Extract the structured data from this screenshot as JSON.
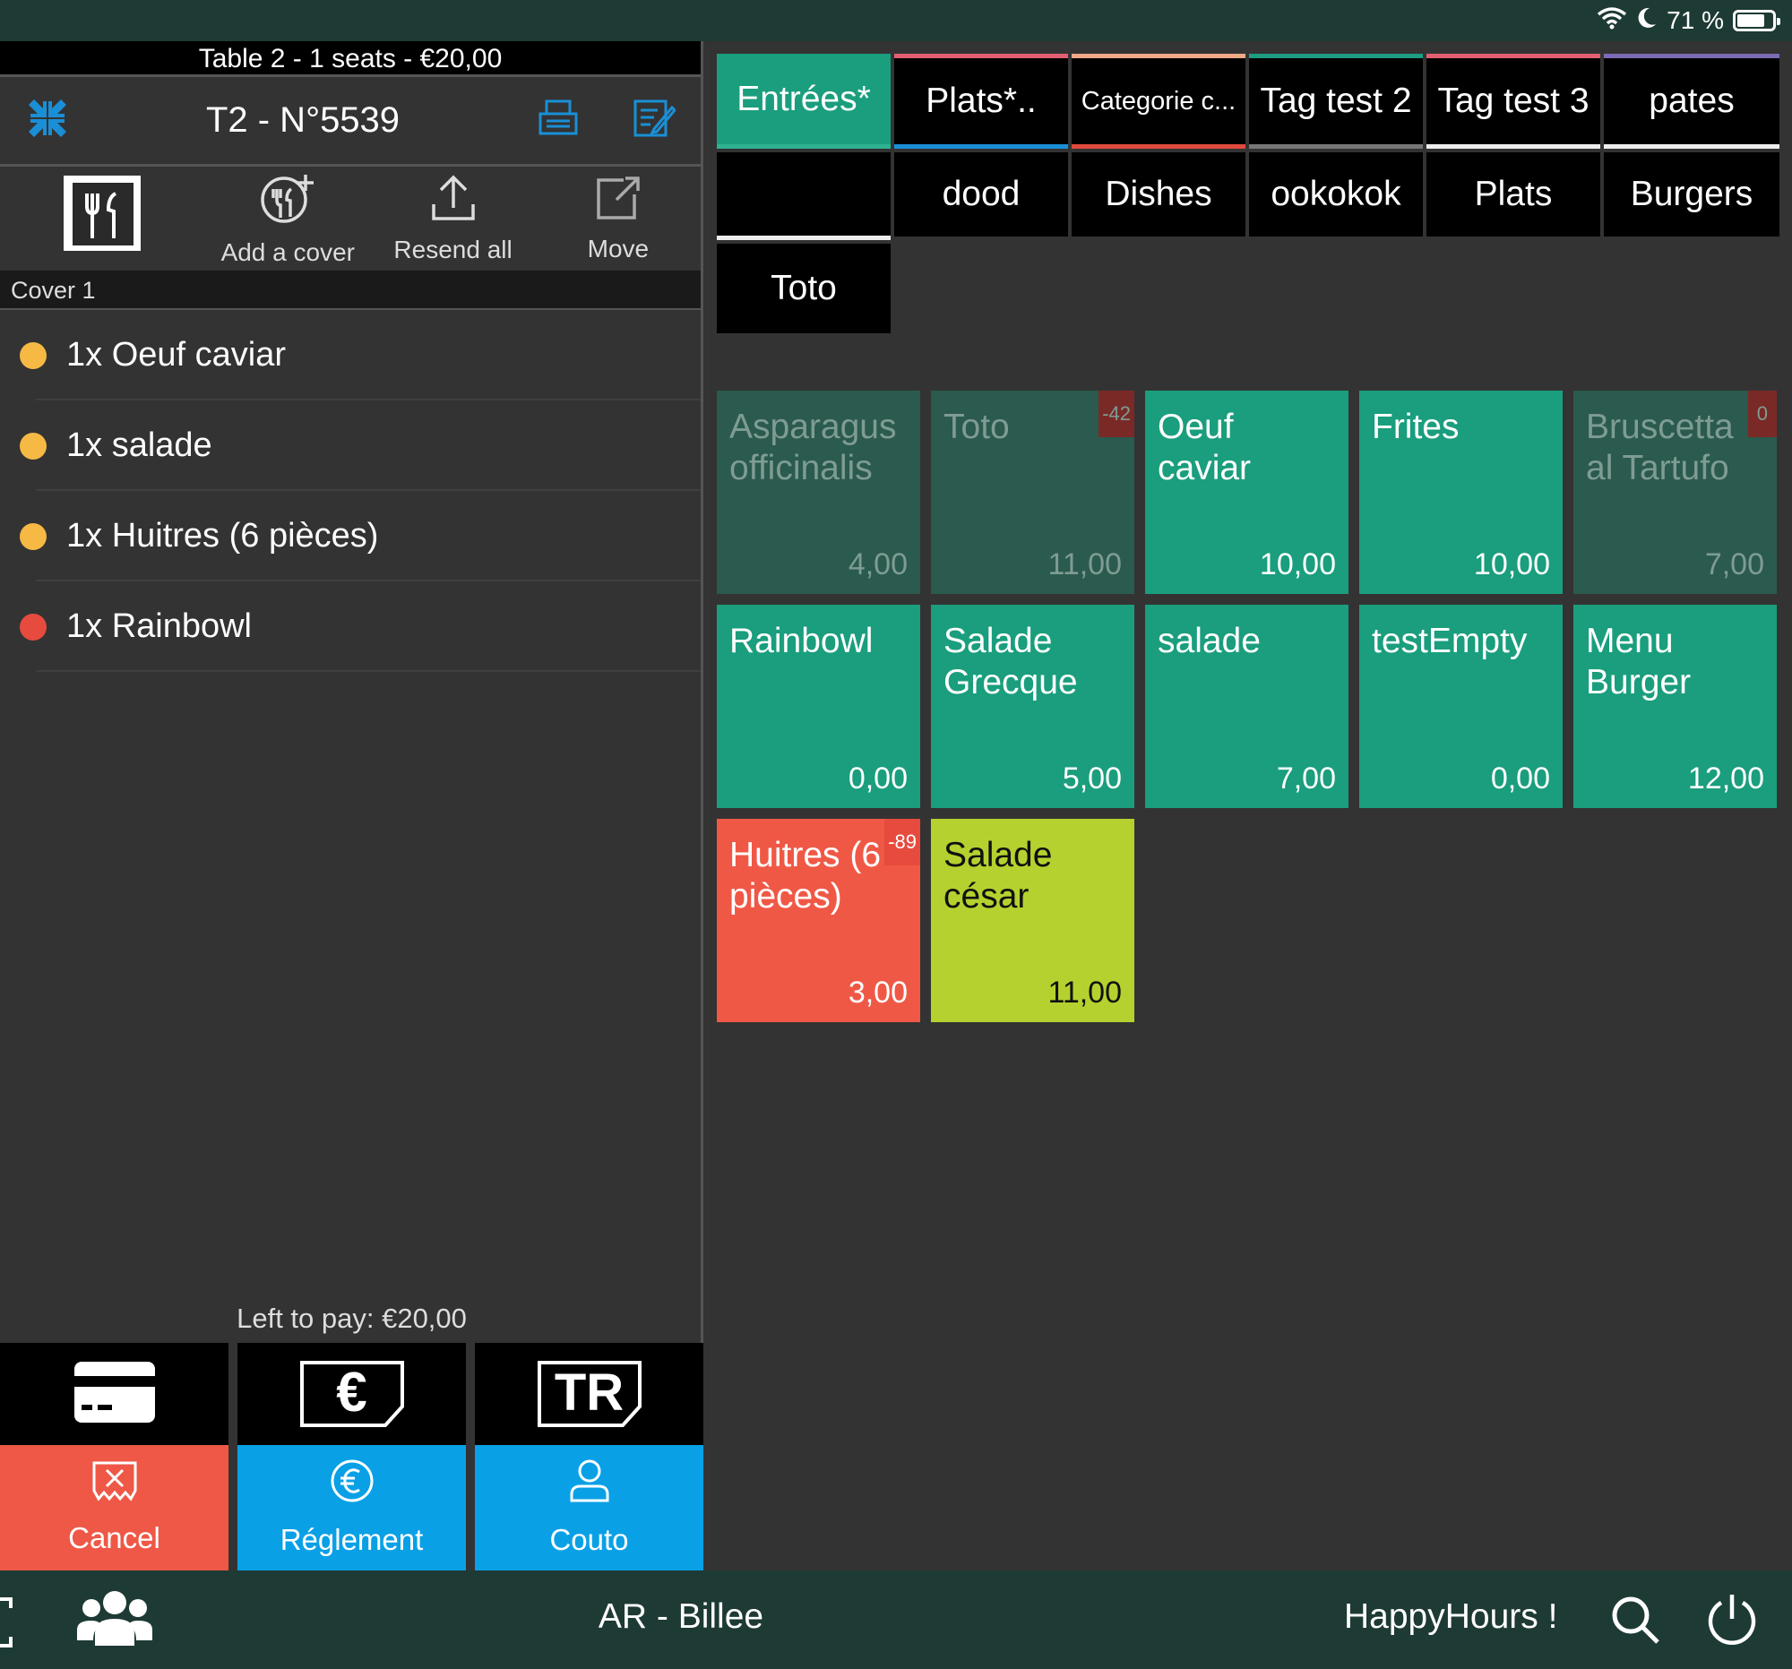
{
  "status_bar": {
    "battery_text": "71 %"
  },
  "order": {
    "table_header": "Table 2 - 1 seats - €20,00",
    "ticket_title": "T2 - N°5539",
    "actions": [
      {
        "label": ""
      },
      {
        "label": "Add a cover"
      },
      {
        "label": "Resend all"
      },
      {
        "label": "Move"
      }
    ],
    "cover_label": "Cover 1",
    "lines": [
      {
        "text": "1x Oeuf caviar",
        "status_color": "#f5b944"
      },
      {
        "text": "1x salade",
        "status_color": "#f5b944"
      },
      {
        "text": "1x Huitres (6 pièces)",
        "status_color": "#f5b944"
      },
      {
        "text": "1x Rainbowl",
        "status_color": "#e64b3e"
      }
    ],
    "left_to_pay": "Left to pay: €20,00",
    "payment_methods": [
      "card-icon",
      "cash-icon",
      "ticket-restaurant-icon"
    ],
    "pay_icon_text": {
      "cash": "€",
      "tr": "TR"
    },
    "buttons": {
      "cancel": "Cancel",
      "payment": "Réglement",
      "waiter": "Couto"
    }
  },
  "categories": {
    "row1": [
      {
        "label": "Entrées*",
        "selected": true,
        "color": "#2db191"
      },
      {
        "label": "Plats*..",
        "color": "#e25f72"
      },
      {
        "label": "Categorie c...",
        "color": "#f0a889"
      },
      {
        "label": "Tag test 2",
        "color": "#1e9c83"
      },
      {
        "label": "Tag test 3",
        "color": "#e25f72"
      },
      {
        "label": "pates",
        "color": "#7b6bb3"
      }
    ],
    "row2": [
      "",
      "dood",
      "Dishes",
      "ookokok",
      "Plats",
      "Burgers"
    ],
    "row3": [
      "Toto"
    ]
  },
  "products": [
    {
      "name": "Asparagus officinalis",
      "price": "4,00",
      "disabled": true
    },
    {
      "name": "Toto",
      "price": "11,00",
      "disabled": true,
      "stock": "-42"
    },
    {
      "name": "Oeuf caviar",
      "price": "10,00"
    },
    {
      "name": "Frites",
      "price": "10,00"
    },
    {
      "name": "Bruscetta al Tartufo",
      "price": "7,00",
      "disabled": true,
      "stock": "0"
    },
    {
      "name": "Rainbowl",
      "price": "0,00"
    },
    {
      "name": "Salade Grecque",
      "price": "5,00"
    },
    {
      "name": "salade",
      "price": "7,00"
    },
    {
      "name": "testEmpty",
      "price": "0,00"
    },
    {
      "name": "Menu Burger",
      "price": "12,00"
    },
    {
      "name": "Huitres (6 pièces)",
      "price": "3,00",
      "color": "#f05846",
      "stock": "-89"
    },
    {
      "name": "Salade césar",
      "price": "11,00",
      "color": "#b5d12f",
      "dark_text": true
    }
  ],
  "colors": {
    "product_green": "#1a9e7d",
    "product_disabled": "#2b5a4e",
    "cancel": "#ef5846",
    "blue": "#0aa0e6",
    "bars": "#1e3a34"
  },
  "bottom_bar": {
    "server": "AR - Billee",
    "happy_hours": "HappyHours !"
  }
}
